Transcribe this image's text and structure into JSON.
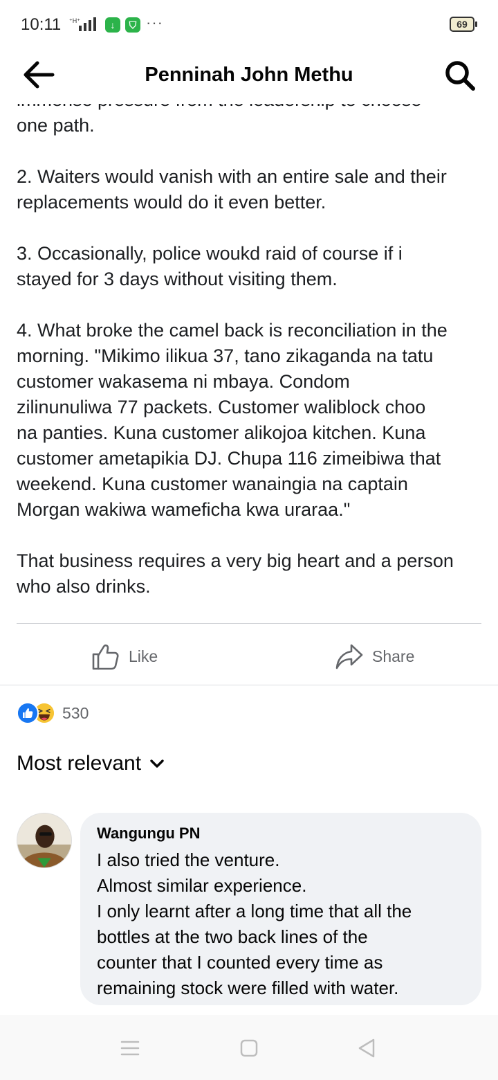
{
  "status_bar": {
    "time": "10:11",
    "more": "···",
    "battery": "69",
    "download_icon": "download-icon",
    "vpn_icon": "shield-icon"
  },
  "header": {
    "title": "Penninah John Methu",
    "back_icon": "arrow-left-icon",
    "search_icon": "search-icon"
  },
  "post": {
    "paragraphs": [
      {
        "lines": [
          "immense pressure from the leadership to choose",
          "one path."
        ]
      },
      {
        "lines": [
          "2. Waiters would vanish with an entire sale and their",
          "replacements would do it even better."
        ]
      },
      {
        "lines": [
          "3. Occasionally, police woukd raid of course if i",
          "stayed for 3 days without visiting them."
        ]
      },
      {
        "lines": [
          "4. What broke the camel back is reconciliation in the",
          "morning. \"Mikimo ilikua 37, tano zikaganda na tatu",
          "customer wakasema ni mbaya. Condom",
          "zilinunuliwa 77 packets. Customer waliblock choo",
          "na panties. Kuna customer alikojoa kitchen. Kuna",
          "customer ametapikia DJ. Chupa 116 zimeibiwa that",
          "weekend. Kuna customer wanaingia na captain",
          "Morgan wakiwa wameficha kwa uraraa.\""
        ]
      },
      {
        "lines": [
          "That business requires a very big heart and a person",
          "who also drinks."
        ]
      }
    ]
  },
  "actions": {
    "like_label": "Like",
    "share_label": "Share"
  },
  "reactions": {
    "count": "530",
    "icons": [
      "like-reaction-icon",
      "haha-reaction-icon"
    ]
  },
  "comments": {
    "sort_label": "Most relevant",
    "items": [
      {
        "author": "Wangungu PN",
        "lines": [
          "I also tried the venture.",
          "Almost similar experience.",
          "I only learnt after a long time that all the",
          "bottles at the two back lines of the",
          "counter that I counted every time as",
          "remaining stock were filled with water."
        ]
      }
    ]
  },
  "colors": {
    "accent": "#1877f2",
    "muted": "#65676b",
    "bubble": "#f0f2f5"
  }
}
